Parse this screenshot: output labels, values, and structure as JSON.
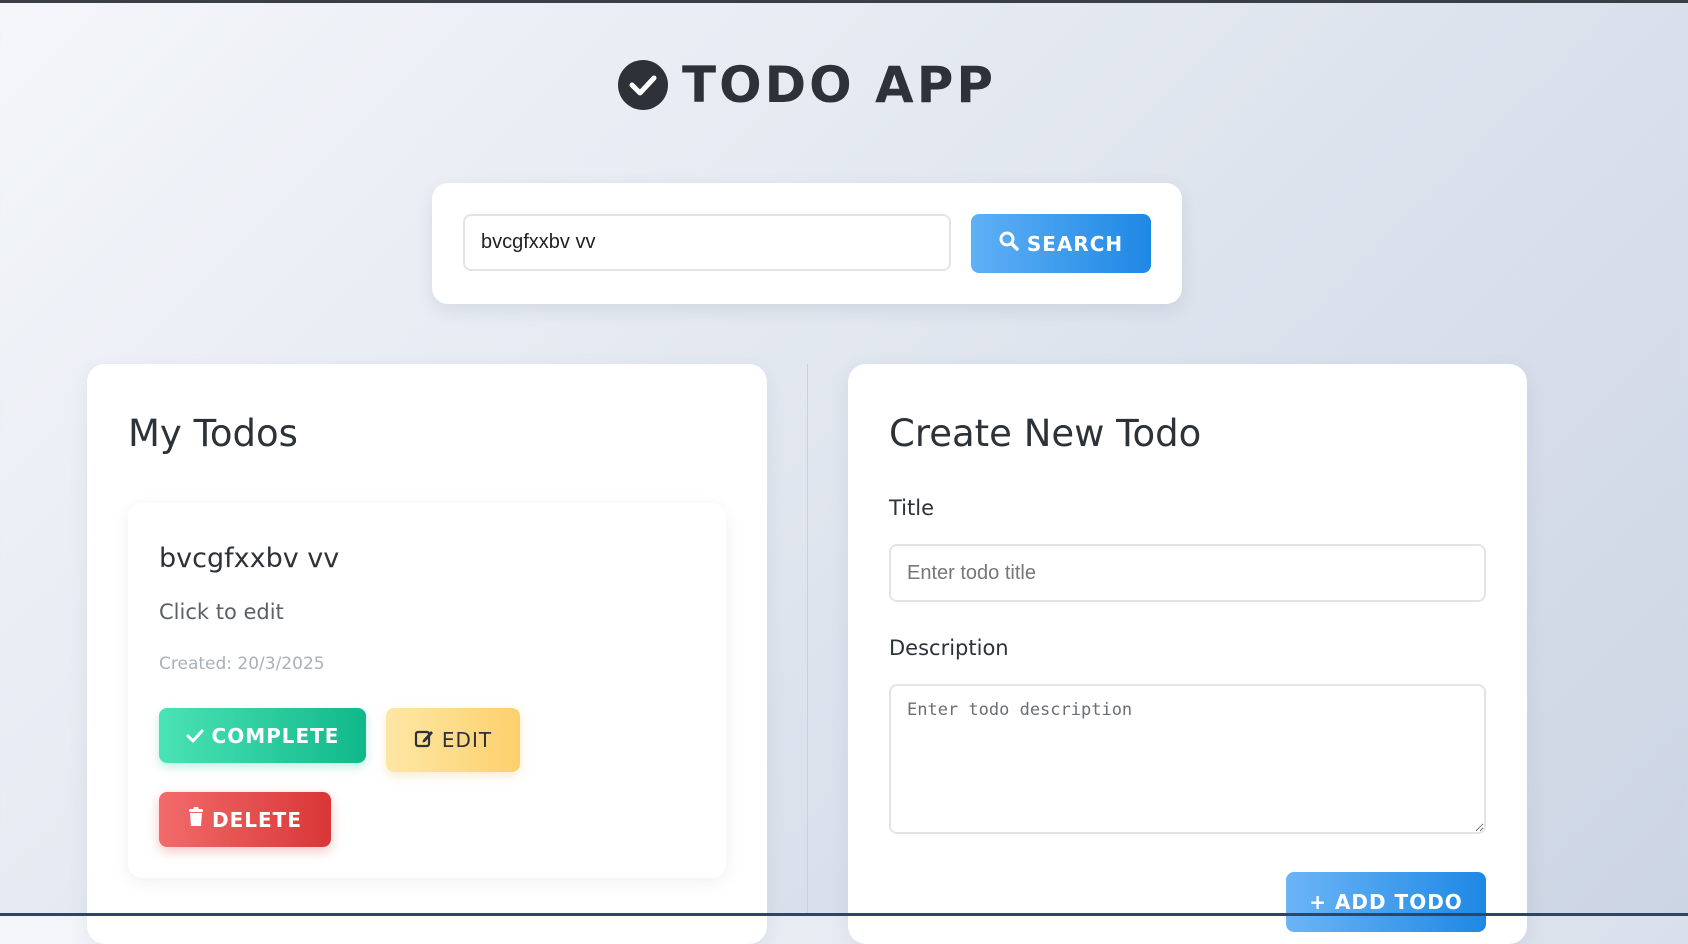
{
  "app": {
    "title": "TODO APP"
  },
  "search": {
    "value": "bvcgfxxbv vv",
    "button_label": "SEARCH"
  },
  "todos_panel": {
    "heading": "My Todos",
    "items": [
      {
        "title": "bvcgfxxbv vv",
        "description": "Click to edit",
        "created": "Created: 20/3/2025",
        "complete_label": "COMPLETE",
        "edit_label": "EDIT",
        "delete_label": "DELETE"
      }
    ]
  },
  "create_panel": {
    "heading": "Create New Todo",
    "title_label": "Title",
    "title_placeholder": "Enter todo title",
    "description_label": "Description",
    "description_placeholder": "Enter todo description",
    "add_label": "+ ADD TODO"
  },
  "colors": {
    "primary_blue": "#1e88e5",
    "complete_green": "#10b88a",
    "edit_yellow": "#fdd06c",
    "delete_red": "#d93636"
  },
  "icons": [
    "check-circle-icon",
    "search-icon",
    "check-icon",
    "edit-icon",
    "trash-icon"
  ]
}
